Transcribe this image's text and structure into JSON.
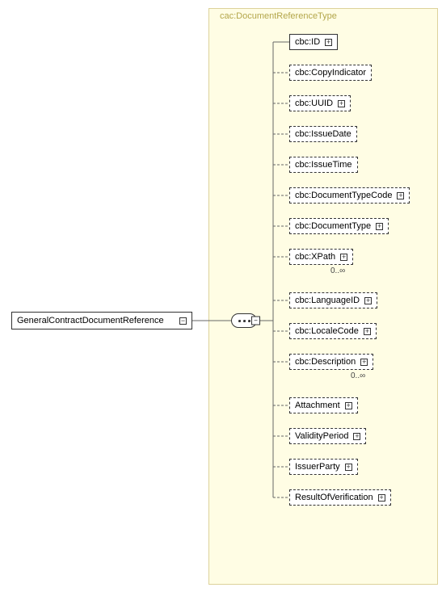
{
  "type_label": "cac:DocumentReferenceType",
  "root": {
    "label": "GeneralContractDocumentReference"
  },
  "children": [
    {
      "label": "cbc:ID",
      "optional": false,
      "expandable": true,
      "cardinality": null
    },
    {
      "label": "cbc:CopyIndicator",
      "optional": true,
      "expandable": false,
      "cardinality": null
    },
    {
      "label": "cbc:UUID",
      "optional": true,
      "expandable": true,
      "cardinality": null
    },
    {
      "label": "cbc:IssueDate",
      "optional": true,
      "expandable": false,
      "cardinality": null
    },
    {
      "label": "cbc:IssueTime",
      "optional": true,
      "expandable": false,
      "cardinality": null
    },
    {
      "label": "cbc:DocumentTypeCode",
      "optional": true,
      "expandable": true,
      "cardinality": null
    },
    {
      "label": "cbc:DocumentType",
      "optional": true,
      "expandable": true,
      "cardinality": null
    },
    {
      "label": "cbc:XPath",
      "optional": true,
      "expandable": true,
      "cardinality": "0..∞"
    },
    {
      "label": "cbc:LanguageID",
      "optional": true,
      "expandable": true,
      "cardinality": null
    },
    {
      "label": "cbc:LocaleCode",
      "optional": true,
      "expandable": true,
      "cardinality": null
    },
    {
      "label": "cbc:Description",
      "optional": true,
      "expandable": true,
      "cardinality": "0..∞"
    },
    {
      "label": "Attachment",
      "optional": true,
      "expandable": true,
      "cardinality": null
    },
    {
      "label": "ValidityPeriod",
      "optional": true,
      "expandable": true,
      "cardinality": null
    },
    {
      "label": "IssuerParty",
      "optional": true,
      "expandable": true,
      "cardinality": null
    },
    {
      "label": "ResultOfVerification",
      "optional": true,
      "expandable": true,
      "cardinality": null
    }
  ],
  "icons": {
    "plus": "+",
    "minus": "−"
  }
}
